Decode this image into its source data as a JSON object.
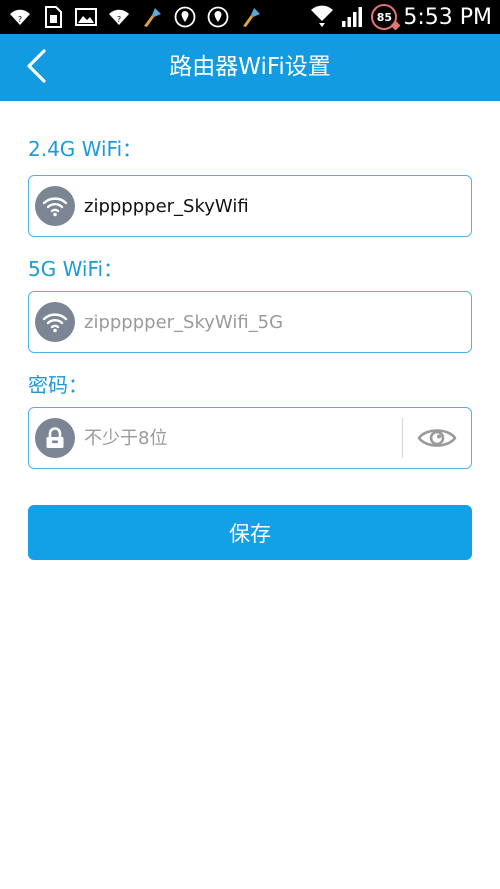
{
  "status_bar": {
    "time": "5:53 PM",
    "battery_level": "85",
    "icons": [
      "wifi-icon",
      "sim-icon",
      "image-icon",
      "wifi-icon",
      "broom-icon",
      "location-icon",
      "location-icon",
      "broom-icon",
      "wifi-signal-icon",
      "cell-signal-icon",
      "battery-icon"
    ]
  },
  "header": {
    "title": "路由器WiFi设置",
    "back_icon": "chevron-left-icon",
    "background": "#129be0"
  },
  "form": {
    "wifi24": {
      "label": "2.4G WiFi：",
      "value": "zippppper_SkyWifi",
      "icon": "wifi-icon"
    },
    "wifi5": {
      "label": "5G WiFi：",
      "value": "zippppper_SkyWifi_5G",
      "icon": "wifi-icon"
    },
    "password": {
      "label": "密码：",
      "placeholder": "不少于8位",
      "icon": "lock-icon",
      "toggle_icon": "eye-icon"
    },
    "save_label": "保存"
  },
  "colors": {
    "accent": "#129be0",
    "label": "#1e9ad9",
    "input_border": "#4fb3e8",
    "icon_circle": "#7c8593"
  }
}
